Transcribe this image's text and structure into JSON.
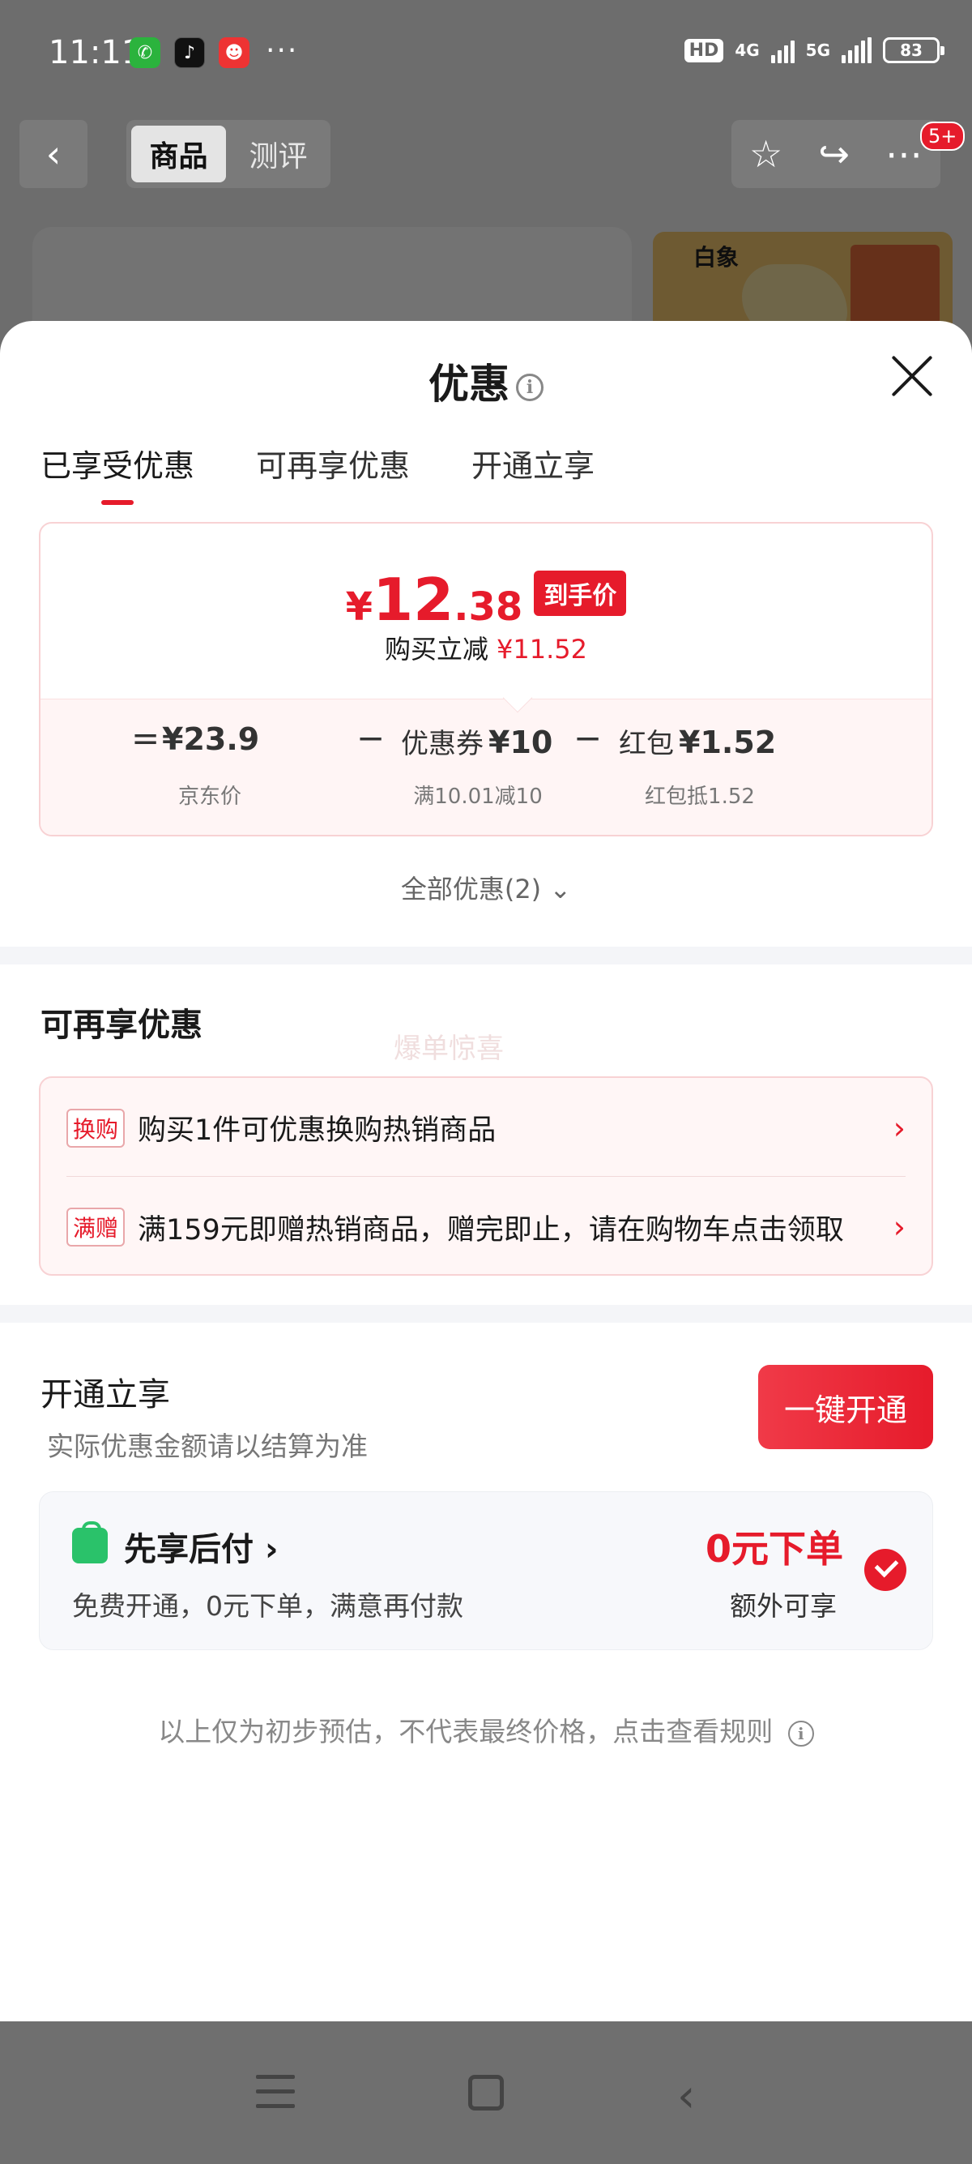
{
  "status_bar": {
    "time": "11:11",
    "apps": [
      "wechat-icon",
      "tiktok-icon",
      "game-icon"
    ],
    "more": "···",
    "hd": "HD",
    "net1": "4G",
    "net2": "5G",
    "battery": "83"
  },
  "page_nav": {
    "back": "‹",
    "segments": [
      "商品",
      "测评"
    ],
    "active_segment": "商品",
    "badge": "5+"
  },
  "background_thumb": {
    "brand": "白象"
  },
  "sheet": {
    "title": "优惠",
    "tabs": [
      "已享受优惠",
      "可再享优惠",
      "开通立享"
    ],
    "active_tab": "已享受优惠",
    "price_card": {
      "currency": "¥",
      "final_int": "12",
      "final_dec": ".38",
      "final_tag": "到手价",
      "save_label": "购买立减",
      "save_amount": "¥11.52",
      "formula": {
        "eq": "=",
        "minus": "−",
        "jd_price": "¥23.9",
        "jd_label": "京东价",
        "coupon_label": "优惠券",
        "coupon_value": "¥10",
        "coupon_sub": "满10.01减10",
        "redpacket_label": "红包",
        "redpacket_value": "¥1.52",
        "redpacket_sub": "红包抵1.52"
      }
    },
    "all_offers": "全部优惠(2)",
    "more_section": {
      "title": "可再享优惠",
      "watermark": "爆单惊喜",
      "items": [
        {
          "tag": "换购",
          "text": "购买1件可优惠换购热销商品"
        },
        {
          "tag": "满赠",
          "text": "满159元即赠热销商品，赠完即止，请在购物车点击领取"
        }
      ]
    },
    "open_section": {
      "title": "开通立享",
      "subtitle": "实际优惠金额请以结算为准",
      "button": "一键开通",
      "pay_later": {
        "title": "先享后付",
        "desc": "免费开通，0元下单，满意再付款",
        "highlight": "0元下单",
        "extra": "额外可享"
      }
    },
    "disclaimer": "以上仅为初步预估，不代表最终价格，点击查看规则"
  },
  "colors": {
    "accent": "#e61b2b",
    "card_border": "#f8d2d4",
    "card_bg": "#fff6f6"
  }
}
